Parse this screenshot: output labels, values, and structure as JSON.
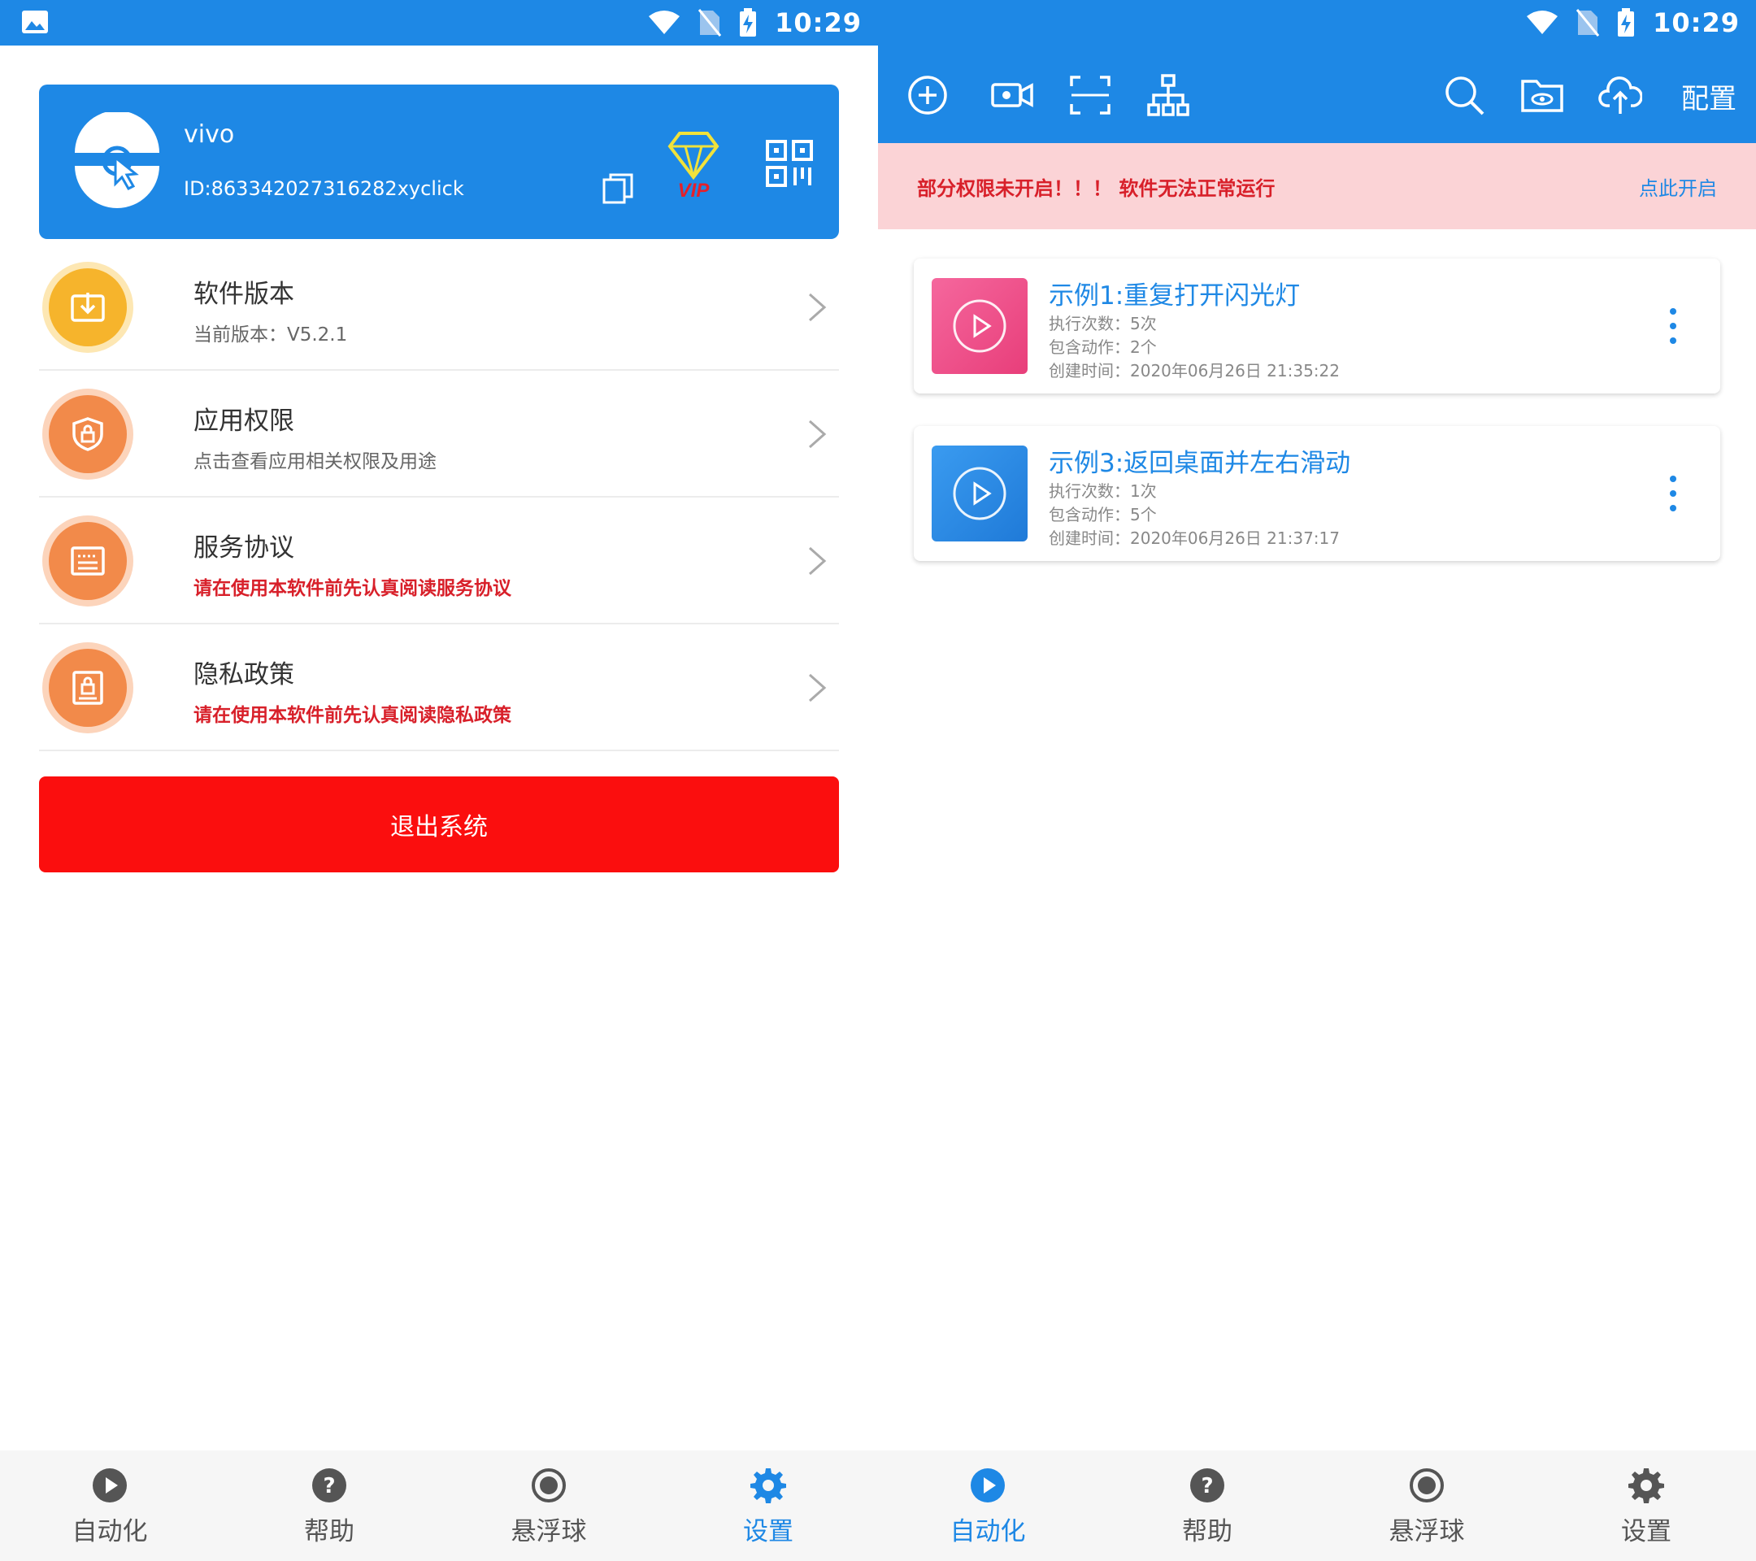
{
  "status_bar": {
    "time": "10:29"
  },
  "settings_screen": {
    "profile": {
      "name": "vivo",
      "id_text": "ID:86334202731​6282xyclick",
      "vip_label": "VIP"
    },
    "menu": [
      {
        "title": "软件版本",
        "subtitle": "当前版本：V5.2.1",
        "icon": "download-icon",
        "warn": false
      },
      {
        "title": "应用权限",
        "subtitle": "点击查看应用相关权限及用途",
        "icon": "shield-lock-icon",
        "warn": false
      },
      {
        "title": "服务协议",
        "subtitle": "请在使用本软件前先认真阅读服务协议",
        "icon": "document-icon",
        "warn": true
      },
      {
        "title": "隐私政策",
        "subtitle": "请在使用本软件前先认真阅读隐私政策",
        "icon": "lock-doc-icon",
        "warn": true
      }
    ],
    "exit_label": "退出系统"
  },
  "automation_screen": {
    "toolbar": {
      "config_label": "配置"
    },
    "warning": {
      "text": "部分权限未开启！！！ 软件无法正常运行",
      "link": "点此开启"
    },
    "tasks": [
      {
        "title": "示例1:重复打开闪光灯",
        "runs": "执行次数：5次",
        "actions": "包含动作：2个",
        "created": "创建时间：2020年06月26日 21:35:22"
      },
      {
        "title": "示例3:返回桌面并左右滑动",
        "runs": "执行次数：1次",
        "actions": "包含动作：5个",
        "created": "创建时间：2020年06月26日 21:37:17"
      }
    ]
  },
  "bottom_nav": {
    "items": [
      {
        "label": "自动化",
        "icon": "play-circle-icon"
      },
      {
        "label": "帮助",
        "icon": "help-icon"
      },
      {
        "label": "悬浮球",
        "icon": "float-ball-icon"
      },
      {
        "label": "设置",
        "icon": "gear-icon"
      }
    ],
    "left_active": "设置",
    "right_active": "自动化"
  },
  "colors": {
    "primary": "#1e88e5",
    "danger": "#fb0e0e",
    "warning_bg": "#fbd3d6",
    "warning_text": "#d8202a",
    "icon_yellow": "#f6b42c",
    "icon_orange": "#f28a4a",
    "task_pink": "#ef4f87",
    "task_blue": "#2b8be3"
  }
}
